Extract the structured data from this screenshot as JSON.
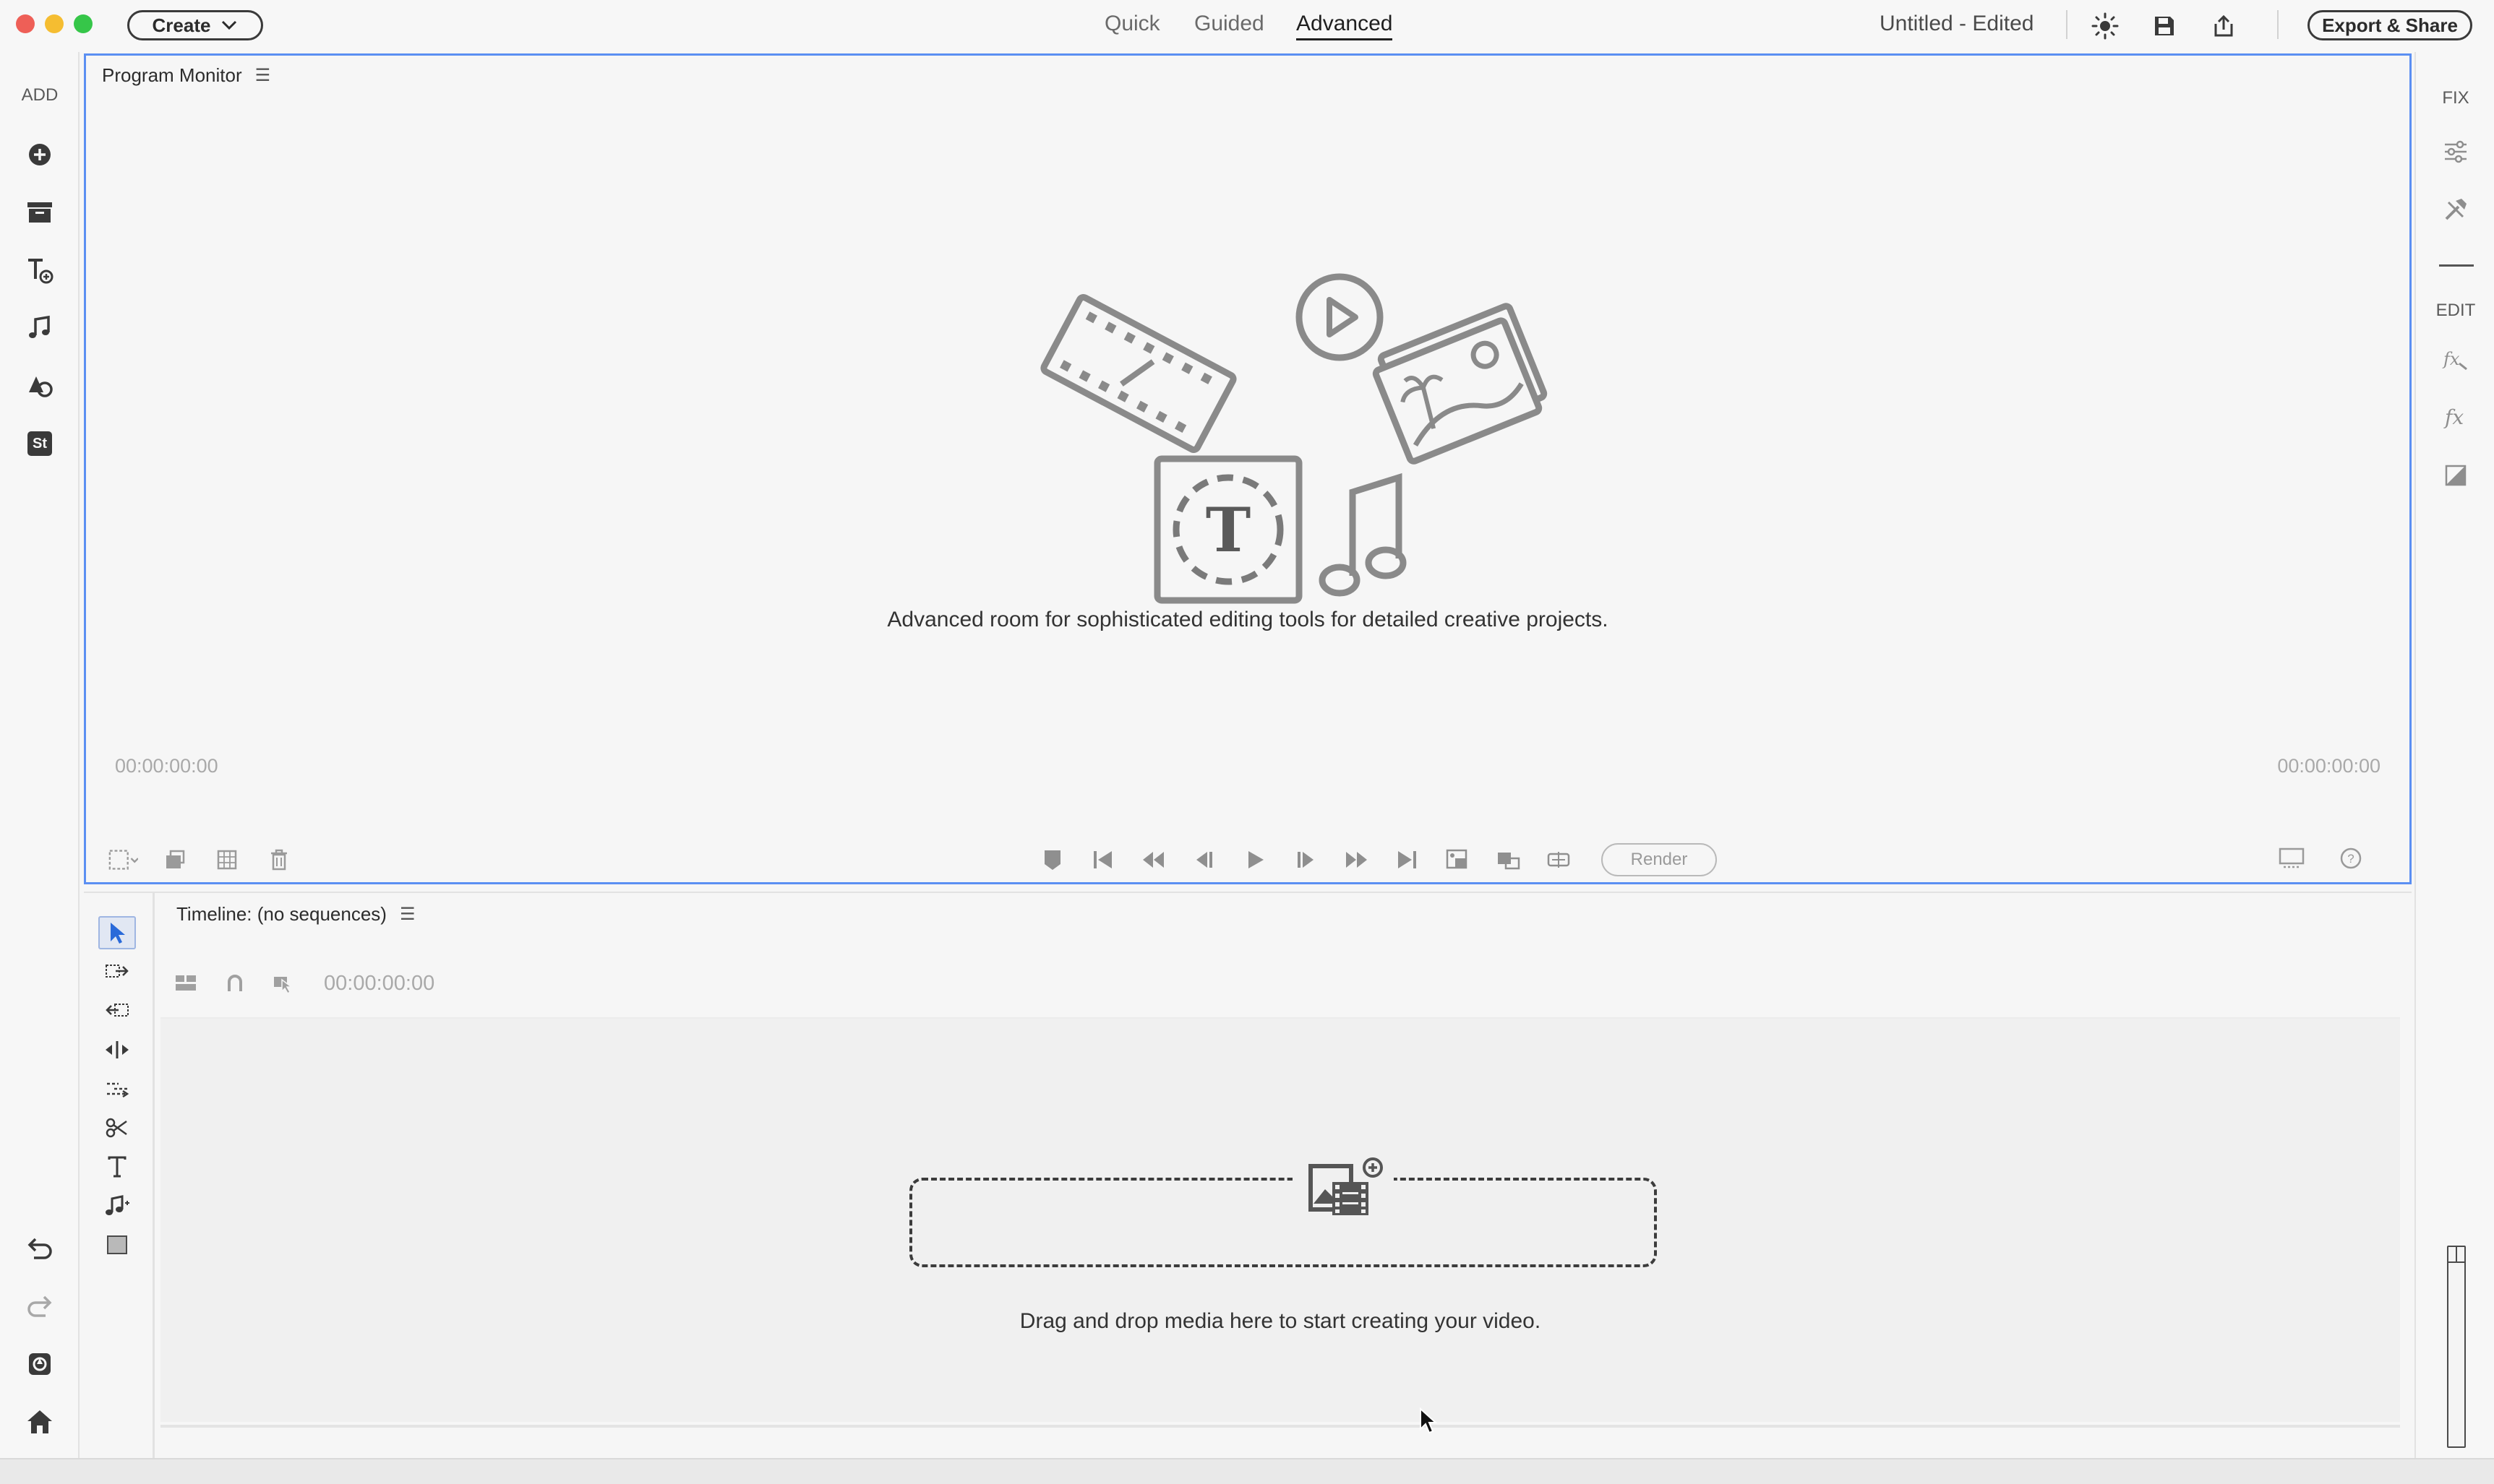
{
  "topbar": {
    "create_label": "Create",
    "tabs": [
      {
        "label": "Quick"
      },
      {
        "label": "Guided"
      },
      {
        "label": "Advanced",
        "active": true
      }
    ],
    "project_title": "Untitled - Edited",
    "export_label": "Export & Share",
    "icons": [
      "brightness-icon",
      "save-icon",
      "share-icon"
    ]
  },
  "left_sidebar": {
    "section_label": "ADD",
    "items": [
      "add-media-icon",
      "media-bin-icon",
      "add-title-icon",
      "audio-icon",
      "graphics-icon",
      "stock-icon"
    ],
    "stock_label": "St",
    "bottom_items": [
      "undo-icon",
      "redo-icon",
      "organizer-icon",
      "home-icon"
    ]
  },
  "right_sidebar": {
    "fix_label": "FIX",
    "edit_label": "EDIT",
    "items": [
      "adjust-icon",
      "tools-icon",
      "effects-animate-icon",
      "effects-icon",
      "color-matte-icon"
    ]
  },
  "program_monitor": {
    "title": "Program Monitor",
    "description": "Advanced room for sophisticated editing tools for detailed creative projects.",
    "time_left": "00:00:00:00",
    "time_right": "00:00:00:00",
    "illustration_glyph": "T",
    "render_label": "Render"
  },
  "timeline": {
    "title": "Timeline: (no sequences)",
    "timecode": "00:00:00:00",
    "drop_text": "Drag and drop media here to start creating your video."
  },
  "colors": {
    "accent": "#5b8ff2",
    "selected_tool": "#2a6ad9",
    "text": "#2c2c2c",
    "muted": "#a9a9a9"
  }
}
